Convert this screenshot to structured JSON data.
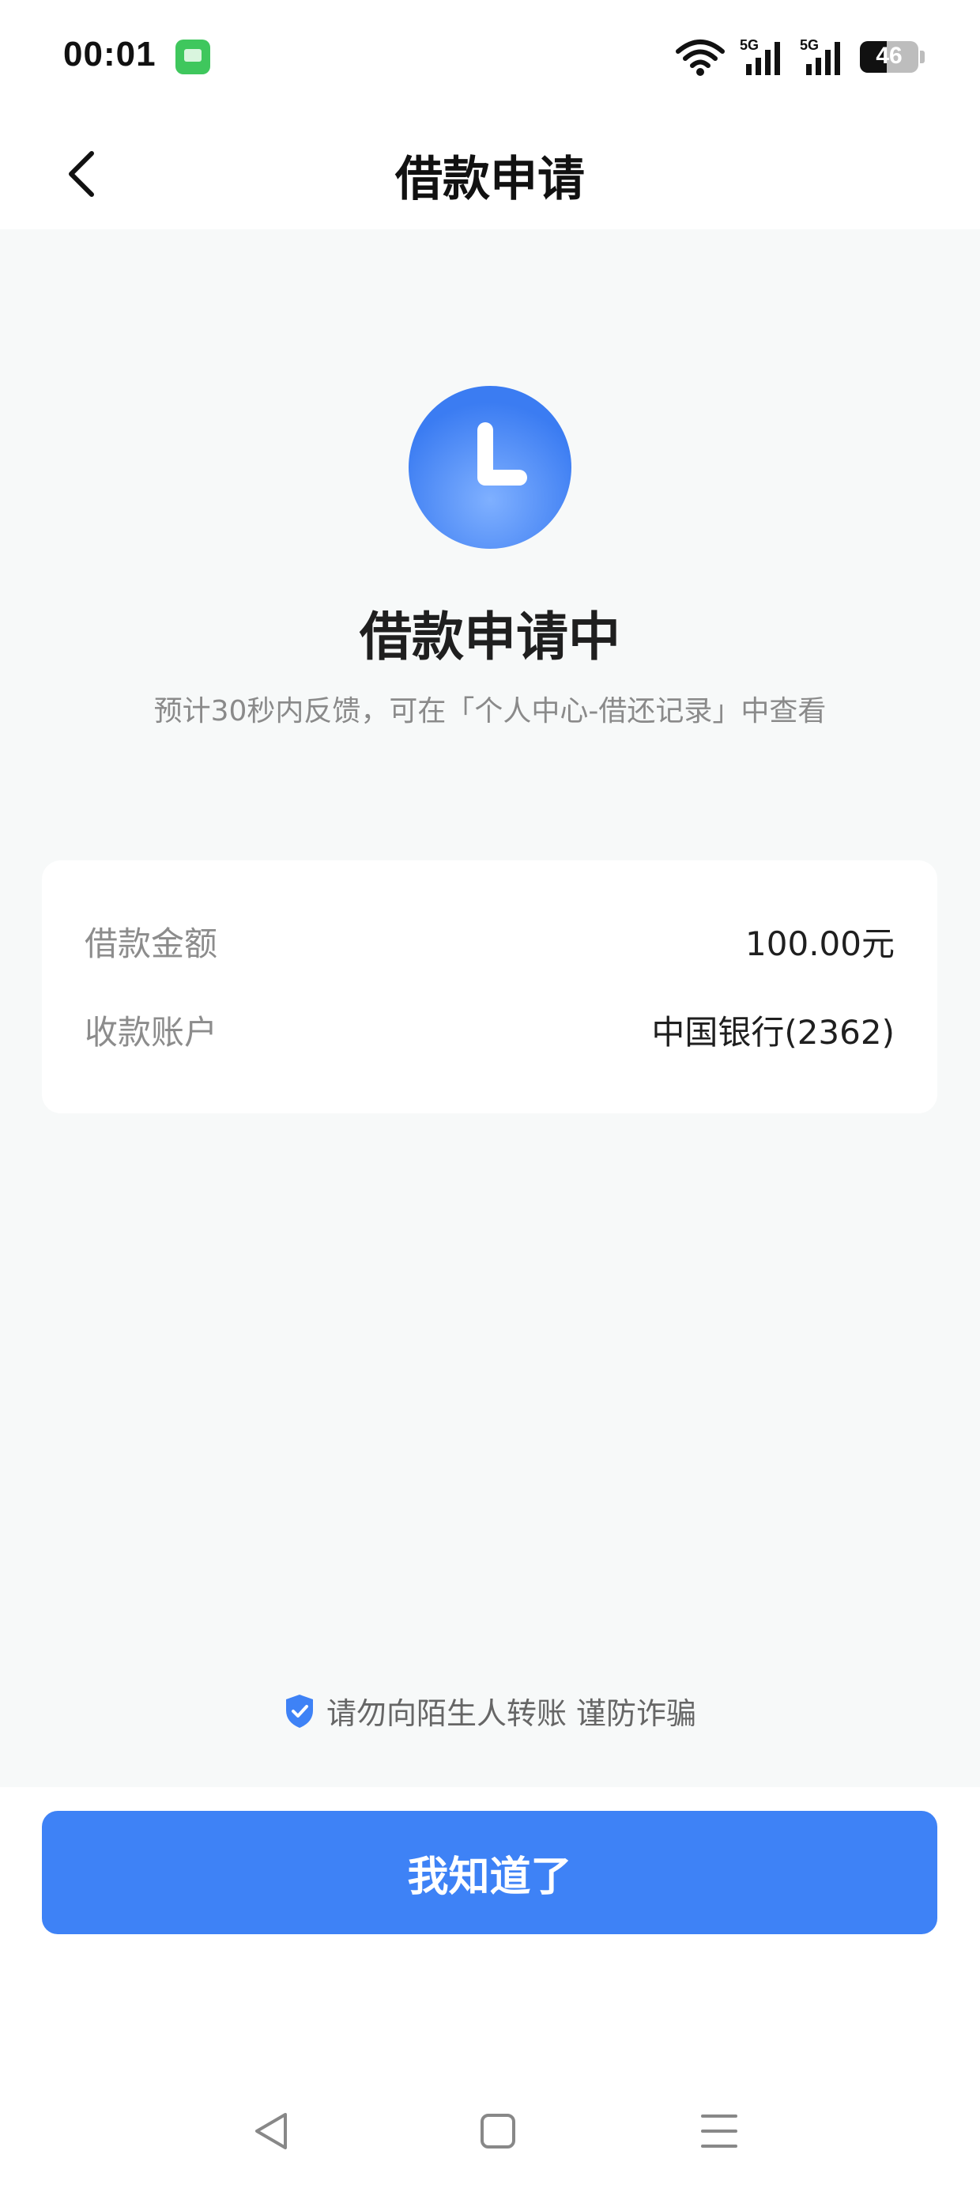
{
  "status_bar": {
    "time": "00:01",
    "battery_level": "46",
    "battery_fraction": 0.46,
    "icons": [
      "message-app-icon",
      "wifi-icon",
      "signal-5g-icon",
      "signal-5g-icon",
      "battery-icon"
    ],
    "signal_label": "5G"
  },
  "header": {
    "title": "借款申请"
  },
  "status": {
    "icon": "clock-icon",
    "title": "借款申请中",
    "subtitle": "预计30秒内反馈，可在「个人中心-借还记录」中查看"
  },
  "details": [
    {
      "label": "借款金额",
      "value": "100.00元"
    },
    {
      "label": "收款账户",
      "value": "中国银行(2362)"
    }
  ],
  "notice": {
    "icon": "shield-check-icon",
    "text": "请勿向陌生人转账 谨防诈骗"
  },
  "primary_button": {
    "label": "我知道了"
  },
  "nav_bar": {
    "items": [
      "back-triangle-icon",
      "home-square-icon",
      "menu-lines-icon"
    ]
  },
  "colors": {
    "accent": "#3e82f6",
    "background": "#f7f9f9",
    "card": "#ffffff",
    "muted_text": "#8c8c8c"
  }
}
